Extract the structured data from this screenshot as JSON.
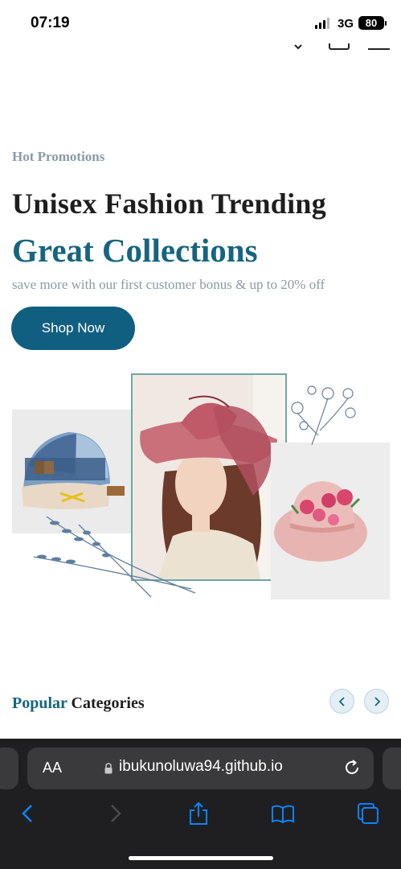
{
  "status": {
    "time": "07:19",
    "network": "3G",
    "battery": "80"
  },
  "hero": {
    "eyebrow": "Hot Promotions",
    "title_line1": "Unisex Fashion Trending",
    "title_line2": "Great Collections",
    "subtitle": "save more with our first customer bonus & up to 20% off",
    "cta_label": "Shop Now"
  },
  "categories": {
    "title_accent": "Popular",
    "title_rest": "Categories",
    "prev_icon": "chevron-left-icon",
    "next_icon": "chevron-right-icon"
  },
  "browser": {
    "text_size_label": "AA",
    "url": "ibukunoluwa94.github.io"
  },
  "colors": {
    "accent": "#115f80",
    "heading": "#1e1e1e",
    "muted": "#8d9aa3",
    "image_frame": "#6ea9a4",
    "browser_bar": "#1f1f21",
    "browser_link": "#0a84ff"
  }
}
